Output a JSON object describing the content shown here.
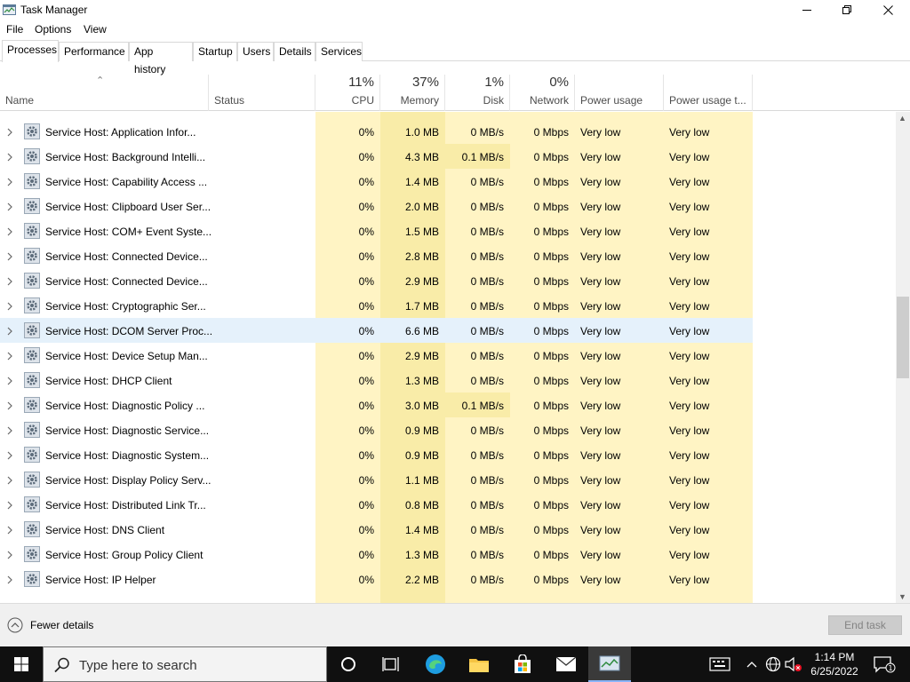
{
  "window": {
    "title": "Task Manager"
  },
  "menu": [
    "File",
    "Options",
    "View"
  ],
  "tabs": [
    "Processes",
    "Performance",
    "App history",
    "Startup",
    "Users",
    "Details",
    "Services"
  ],
  "columns": {
    "name": "Name",
    "status": "Status",
    "cpu": {
      "pct": "11%",
      "label": "CPU"
    },
    "memory": {
      "pct": "37%",
      "label": "Memory"
    },
    "disk": {
      "pct": "1%",
      "label": "Disk"
    },
    "network": {
      "pct": "0%",
      "label": "Network"
    },
    "power": "Power usage",
    "power_trend": "Power usage t..."
  },
  "rows": [
    {
      "name": "Service Host: Application Infor...",
      "cpu": "0%",
      "mem": "1.0 MB",
      "disk": "0 MB/s",
      "net": "0 Mbps",
      "power": "Very low",
      "trend": "Very low"
    },
    {
      "name": "Service Host: Background Intelli...",
      "cpu": "0%",
      "mem": "4.3 MB",
      "disk": "0.1 MB/s",
      "net": "0 Mbps",
      "power": "Very low",
      "trend": "Very low"
    },
    {
      "name": "Service Host: Capability Access ...",
      "cpu": "0%",
      "mem": "1.4 MB",
      "disk": "0 MB/s",
      "net": "0 Mbps",
      "power": "Very low",
      "trend": "Very low"
    },
    {
      "name": "Service Host: Clipboard User Ser...",
      "cpu": "0%",
      "mem": "2.0 MB",
      "disk": "0 MB/s",
      "net": "0 Mbps",
      "power": "Very low",
      "trend": "Very low"
    },
    {
      "name": "Service Host: COM+ Event Syste...",
      "cpu": "0%",
      "mem": "1.5 MB",
      "disk": "0 MB/s",
      "net": "0 Mbps",
      "power": "Very low",
      "trend": "Very low"
    },
    {
      "name": "Service Host: Connected Device...",
      "cpu": "0%",
      "mem": "2.8 MB",
      "disk": "0 MB/s",
      "net": "0 Mbps",
      "power": "Very low",
      "trend": "Very low"
    },
    {
      "name": "Service Host: Connected Device...",
      "cpu": "0%",
      "mem": "2.9 MB",
      "disk": "0 MB/s",
      "net": "0 Mbps",
      "power": "Very low",
      "trend": "Very low"
    },
    {
      "name": "Service Host: Cryptographic Ser...",
      "cpu": "0%",
      "mem": "1.7 MB",
      "disk": "0 MB/s",
      "net": "0 Mbps",
      "power": "Very low",
      "trend": "Very low"
    },
    {
      "name": "Service Host: DCOM Server Proc...",
      "cpu": "0%",
      "mem": "6.6 MB",
      "disk": "0 MB/s",
      "net": "0 Mbps",
      "power": "Very low",
      "trend": "Very low"
    },
    {
      "name": "Service Host: Device Setup Man...",
      "cpu": "0%",
      "mem": "2.9 MB",
      "disk": "0 MB/s",
      "net": "0 Mbps",
      "power": "Very low",
      "trend": "Very low"
    },
    {
      "name": "Service Host: DHCP Client",
      "cpu": "0%",
      "mem": "1.3 MB",
      "disk": "0 MB/s",
      "net": "0 Mbps",
      "power": "Very low",
      "trend": "Very low"
    },
    {
      "name": "Service Host: Diagnostic Policy ...",
      "cpu": "0%",
      "mem": "3.0 MB",
      "disk": "0.1 MB/s",
      "net": "0 Mbps",
      "power": "Very low",
      "trend": "Very low"
    },
    {
      "name": "Service Host: Diagnostic Service...",
      "cpu": "0%",
      "mem": "0.9 MB",
      "disk": "0 MB/s",
      "net": "0 Mbps",
      "power": "Very low",
      "trend": "Very low"
    },
    {
      "name": "Service Host: Diagnostic System...",
      "cpu": "0%",
      "mem": "0.9 MB",
      "disk": "0 MB/s",
      "net": "0 Mbps",
      "power": "Very low",
      "trend": "Very low"
    },
    {
      "name": "Service Host: Display Policy Serv...",
      "cpu": "0%",
      "mem": "1.1 MB",
      "disk": "0 MB/s",
      "net": "0 Mbps",
      "power": "Very low",
      "trend": "Very low"
    },
    {
      "name": "Service Host: Distributed Link Tr...",
      "cpu": "0%",
      "mem": "0.8 MB",
      "disk": "0 MB/s",
      "net": "0 Mbps",
      "power": "Very low",
      "trend": "Very low"
    },
    {
      "name": "Service Host: DNS Client",
      "cpu": "0%",
      "mem": "1.4 MB",
      "disk": "0 MB/s",
      "net": "0 Mbps",
      "power": "Very low",
      "trend": "Very low"
    },
    {
      "name": "Service Host: Group Policy Client",
      "cpu": "0%",
      "mem": "1.3 MB",
      "disk": "0 MB/s",
      "net": "0 Mbps",
      "power": "Very low",
      "trend": "Very low"
    },
    {
      "name": "Service Host: IP Helper",
      "cpu": "0%",
      "mem": "2.2 MB",
      "disk": "0 MB/s",
      "net": "0 Mbps",
      "power": "Very low",
      "trend": "Very low"
    }
  ],
  "hovered_row": 8,
  "footer": {
    "fewer_details": "Fewer details",
    "end_task": "End task"
  },
  "taskbar": {
    "search_placeholder": "Type here to search",
    "time": "1:14 PM",
    "date": "6/25/2022",
    "notification_count": "1"
  },
  "colors": {
    "cpu_bg": "#fff4c4",
    "mem_bg": "#f9eca8",
    "hover_bg": "#e5f1fb",
    "disk_hot": "#f9eca8"
  }
}
